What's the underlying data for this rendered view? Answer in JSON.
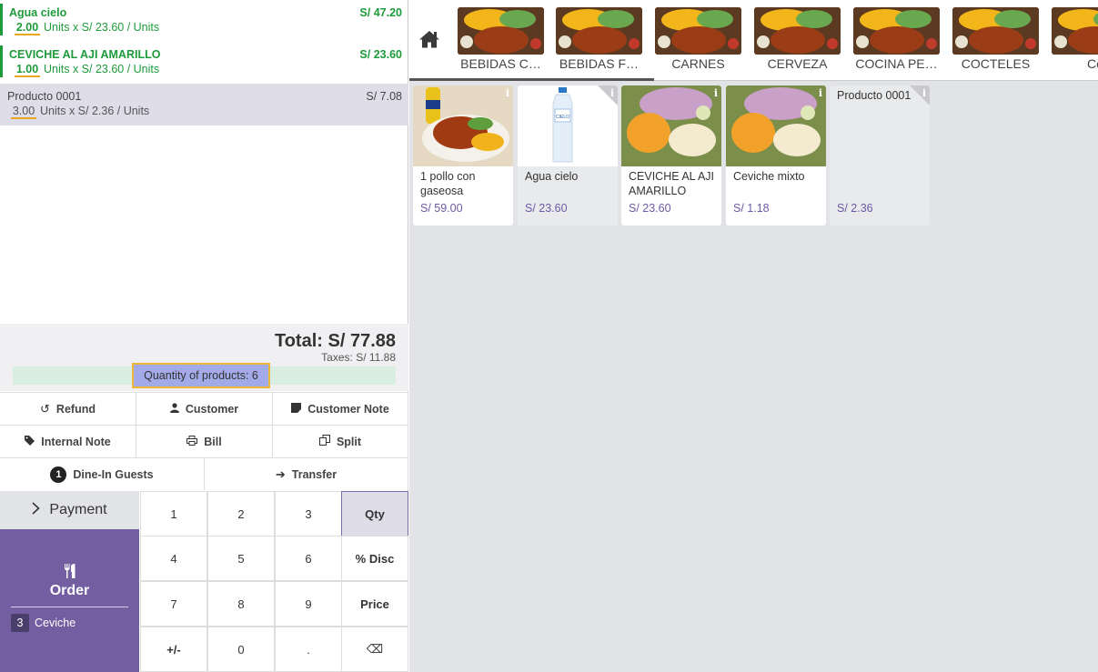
{
  "order_lines": [
    {
      "name": "Agua cielo",
      "price": "S/ 47.20",
      "qty": "2.00",
      "detail": "Units x S/ 23.60 / Units"
    },
    {
      "name": "CEVICHE AL AJI AMARILLO",
      "price": "S/ 23.60",
      "qty": "1.00",
      "detail": "Units x S/ 23.60 / Units"
    },
    {
      "name": "Producto 0001",
      "price": "S/ 7.08",
      "qty": "3.00",
      "detail": "Units x S/ 2.36 / Units"
    }
  ],
  "summary": {
    "total": "Total: S/ 77.88",
    "taxes": "Taxes: S/ 11.88",
    "quantity": "Quantity of products: 6"
  },
  "controls": {
    "refund": "Refund",
    "customer": "Customer",
    "customer_note": "Customer Note",
    "internal_note": "Internal Note",
    "bill": "Bill",
    "split": "Split",
    "guests_count": "1",
    "guests": "Dine-In Guests",
    "transfer": "Transfer"
  },
  "payment": {
    "label": "Payment"
  },
  "order": {
    "label": "Order",
    "tag_count": "3",
    "tag_label": "Ceviche"
  },
  "numpad": [
    [
      "1",
      "2",
      "3",
      "Qty"
    ],
    [
      "4",
      "5",
      "6",
      "% Disc"
    ],
    [
      "7",
      "8",
      "9",
      "Price"
    ],
    [
      "+/-",
      "0",
      ".",
      "⌫"
    ]
  ],
  "active_mode": "Qty",
  "categories": [
    "BEBIDAS C…",
    "BEBIDAS F…",
    "CARNES",
    "CERVEZA",
    "COCINA PE…",
    "COCTELES",
    "Cevic"
  ],
  "products": [
    {
      "name": "1 pollo con gaseosa",
      "price": "S/ 59.00"
    },
    {
      "name": "Agua cielo",
      "price": "S/ 23.60"
    },
    {
      "name": "CEVICHE AL AJI AMARILLO",
      "price": "S/ 23.60"
    },
    {
      "name": "Ceviche mixto",
      "price": "S/ 1.18"
    },
    {
      "name": "Producto 0001",
      "price": "S/ 2.36"
    }
  ],
  "colors": {
    "accent": "#725ea1",
    "green": "#1d9b3b",
    "price_purple": "#6d5aa5"
  },
  "icons": {
    "home": "home-icon",
    "info": "info-icon"
  }
}
